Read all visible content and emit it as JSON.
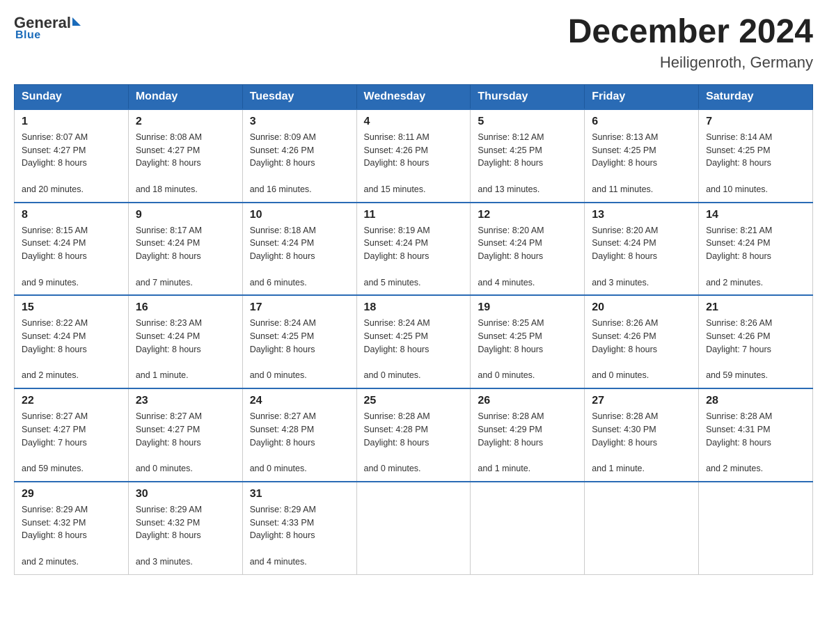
{
  "logo": {
    "general": "General",
    "blue": "Blue",
    "tagline": "Blue"
  },
  "title": "December 2024",
  "subtitle": "Heiligenroth, Germany",
  "days_of_week": [
    "Sunday",
    "Monday",
    "Tuesday",
    "Wednesday",
    "Thursday",
    "Friday",
    "Saturday"
  ],
  "weeks": [
    [
      {
        "day": "1",
        "sunrise": "8:07 AM",
        "sunset": "4:27 PM",
        "daylight": "8 hours and 20 minutes."
      },
      {
        "day": "2",
        "sunrise": "8:08 AM",
        "sunset": "4:27 PM",
        "daylight": "8 hours and 18 minutes."
      },
      {
        "day": "3",
        "sunrise": "8:09 AM",
        "sunset": "4:26 PM",
        "daylight": "8 hours and 16 minutes."
      },
      {
        "day": "4",
        "sunrise": "8:11 AM",
        "sunset": "4:26 PM",
        "daylight": "8 hours and 15 minutes."
      },
      {
        "day": "5",
        "sunrise": "8:12 AM",
        "sunset": "4:25 PM",
        "daylight": "8 hours and 13 minutes."
      },
      {
        "day": "6",
        "sunrise": "8:13 AM",
        "sunset": "4:25 PM",
        "daylight": "8 hours and 11 minutes."
      },
      {
        "day": "7",
        "sunrise": "8:14 AM",
        "sunset": "4:25 PM",
        "daylight": "8 hours and 10 minutes."
      }
    ],
    [
      {
        "day": "8",
        "sunrise": "8:15 AM",
        "sunset": "4:24 PM",
        "daylight": "8 hours and 9 minutes."
      },
      {
        "day": "9",
        "sunrise": "8:17 AM",
        "sunset": "4:24 PM",
        "daylight": "8 hours and 7 minutes."
      },
      {
        "day": "10",
        "sunrise": "8:18 AM",
        "sunset": "4:24 PM",
        "daylight": "8 hours and 6 minutes."
      },
      {
        "day": "11",
        "sunrise": "8:19 AM",
        "sunset": "4:24 PM",
        "daylight": "8 hours and 5 minutes."
      },
      {
        "day": "12",
        "sunrise": "8:20 AM",
        "sunset": "4:24 PM",
        "daylight": "8 hours and 4 minutes."
      },
      {
        "day": "13",
        "sunrise": "8:20 AM",
        "sunset": "4:24 PM",
        "daylight": "8 hours and 3 minutes."
      },
      {
        "day": "14",
        "sunrise": "8:21 AM",
        "sunset": "4:24 PM",
        "daylight": "8 hours and 2 minutes."
      }
    ],
    [
      {
        "day": "15",
        "sunrise": "8:22 AM",
        "sunset": "4:24 PM",
        "daylight": "8 hours and 2 minutes."
      },
      {
        "day": "16",
        "sunrise": "8:23 AM",
        "sunset": "4:24 PM",
        "daylight": "8 hours and 1 minute."
      },
      {
        "day": "17",
        "sunrise": "8:24 AM",
        "sunset": "4:25 PM",
        "daylight": "8 hours and 0 minutes."
      },
      {
        "day": "18",
        "sunrise": "8:24 AM",
        "sunset": "4:25 PM",
        "daylight": "8 hours and 0 minutes."
      },
      {
        "day": "19",
        "sunrise": "8:25 AM",
        "sunset": "4:25 PM",
        "daylight": "8 hours and 0 minutes."
      },
      {
        "day": "20",
        "sunrise": "8:26 AM",
        "sunset": "4:26 PM",
        "daylight": "8 hours and 0 minutes."
      },
      {
        "day": "21",
        "sunrise": "8:26 AM",
        "sunset": "4:26 PM",
        "daylight": "7 hours and 59 minutes."
      }
    ],
    [
      {
        "day": "22",
        "sunrise": "8:27 AM",
        "sunset": "4:27 PM",
        "daylight": "7 hours and 59 minutes."
      },
      {
        "day": "23",
        "sunrise": "8:27 AM",
        "sunset": "4:27 PM",
        "daylight": "8 hours and 0 minutes."
      },
      {
        "day": "24",
        "sunrise": "8:27 AM",
        "sunset": "4:28 PM",
        "daylight": "8 hours and 0 minutes."
      },
      {
        "day": "25",
        "sunrise": "8:28 AM",
        "sunset": "4:28 PM",
        "daylight": "8 hours and 0 minutes."
      },
      {
        "day": "26",
        "sunrise": "8:28 AM",
        "sunset": "4:29 PM",
        "daylight": "8 hours and 1 minute."
      },
      {
        "day": "27",
        "sunrise": "8:28 AM",
        "sunset": "4:30 PM",
        "daylight": "8 hours and 1 minute."
      },
      {
        "day": "28",
        "sunrise": "8:28 AM",
        "sunset": "4:31 PM",
        "daylight": "8 hours and 2 minutes."
      }
    ],
    [
      {
        "day": "29",
        "sunrise": "8:29 AM",
        "sunset": "4:32 PM",
        "daylight": "8 hours and 2 minutes."
      },
      {
        "day": "30",
        "sunrise": "8:29 AM",
        "sunset": "4:32 PM",
        "daylight": "8 hours and 3 minutes."
      },
      {
        "day": "31",
        "sunrise": "8:29 AM",
        "sunset": "4:33 PM",
        "daylight": "8 hours and 4 minutes."
      },
      null,
      null,
      null,
      null
    ]
  ],
  "labels": {
    "sunrise": "Sunrise:",
    "sunset": "Sunset:",
    "daylight": "Daylight:"
  }
}
